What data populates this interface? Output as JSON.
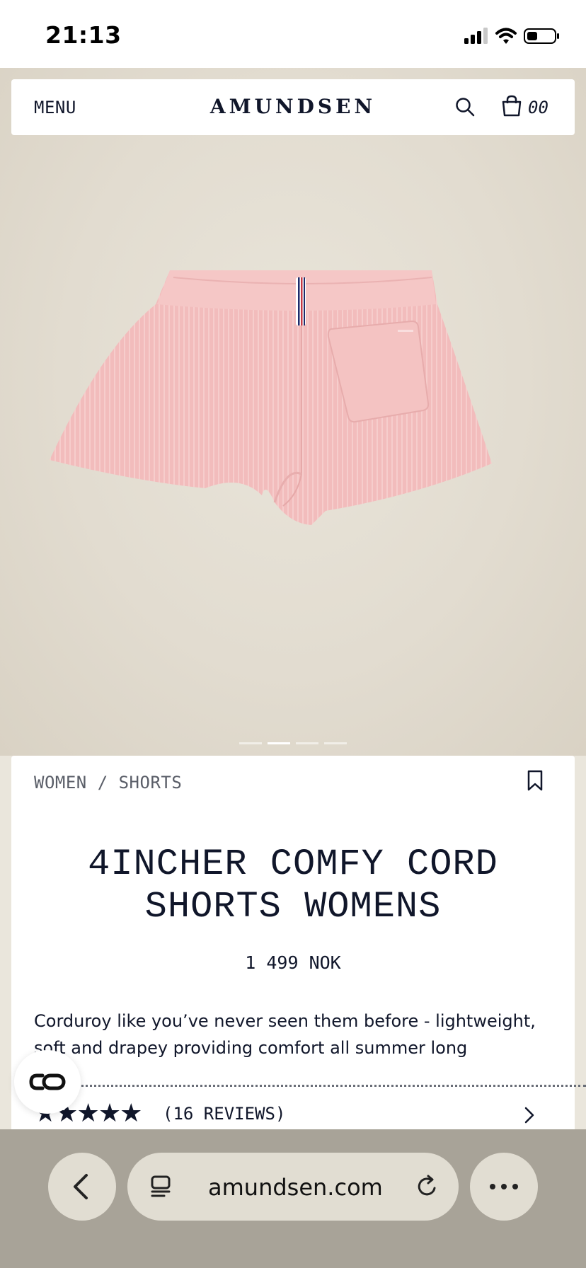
{
  "status_bar": {
    "time": "21:13"
  },
  "header": {
    "menu_label": "MENU",
    "logo": "AMUNDSEN",
    "cart_count": "00"
  },
  "gallery": {
    "slide_count": 4,
    "active_slide": 2
  },
  "product": {
    "breadcrumb": "WOMEN / SHORTS",
    "title_line1": "4INCHER COMFY CORD",
    "title_line2": "SHORTS WOMENS",
    "price": "1 499 NOK",
    "description": "Corduroy like you’ve never seen them before - lightweight, soft and drapey providing comfort all summer long",
    "rating": 5,
    "stars": "★★★★★",
    "reviews_label": "(16 REVIEWS)"
  },
  "browser": {
    "url": "amundsen.com"
  },
  "colors": {
    "ink": "#10162a",
    "shorts_pink": "#f2bcbc",
    "backdrop": "#e4dfd3",
    "browser_bar": "#a8a398",
    "browser_button": "#e1ddd2"
  },
  "icons": [
    "signal-icon",
    "wifi-icon",
    "battery-icon",
    "search-icon",
    "shopping-bag-icon",
    "bookmark-icon",
    "chevron-right-icon",
    "chat-icon",
    "back-chevron-icon",
    "tabs-icon",
    "reload-icon",
    "more-icon"
  ]
}
